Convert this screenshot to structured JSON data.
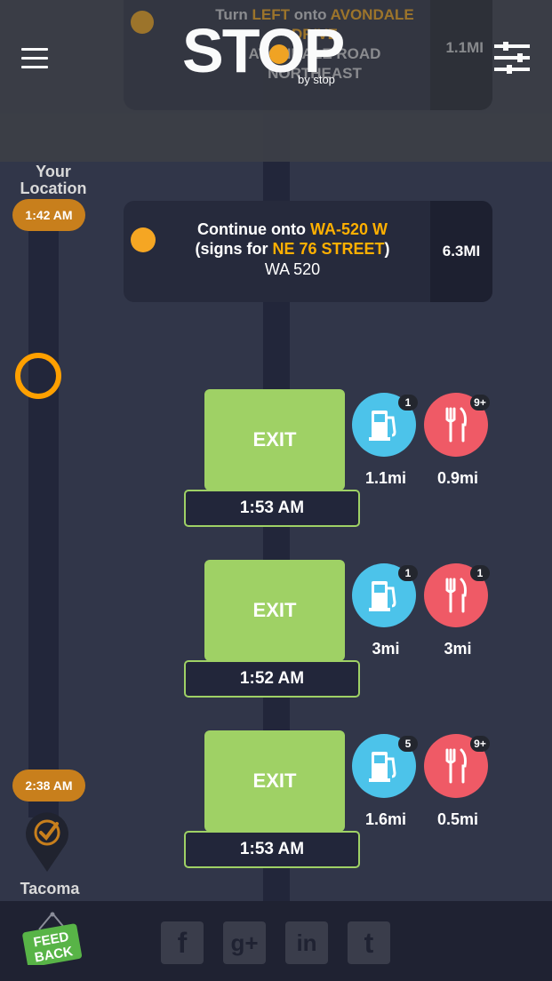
{
  "header": {
    "prev_step": {
      "text_parts": [
        "Turn ",
        "LEFT",
        " onto ",
        "AVONDALE"
      ],
      "line2": "DRIVE",
      "line3": "AVONDALE ROAD",
      "line4": "NORTHEAST",
      "distance": "1.1MI"
    },
    "logo_text": "STOP",
    "logo_sub": "by stop"
  },
  "route": {
    "origin_label": "Your Location",
    "origin_time": "1:42 AM",
    "destination_time": "2:38 AM",
    "destination_label": "Tacoma"
  },
  "direction": {
    "prefix": "Continue onto ",
    "road": "WA-520 W",
    "signs_prefix": "(signs for ",
    "signs_road": "NE 76 STREET",
    "signs_suffix": ")",
    "road_name": "WA 520",
    "distance": "6.3MI"
  },
  "exits": [
    {
      "label": "EXIT",
      "time": "1:53 AM",
      "gas_count": "1",
      "gas_dist": "1.1mi",
      "food_count": "9+",
      "food_dist": "0.9mi"
    },
    {
      "label": "EXIT",
      "time": "1:52 AM",
      "gas_count": "1",
      "gas_dist": "3mi",
      "food_count": "1",
      "food_dist": "3mi"
    },
    {
      "label": "EXIT",
      "time": "1:53 AM",
      "gas_count": "5",
      "gas_dist": "1.6mi",
      "food_count": "9+",
      "food_dist": "0.5mi"
    }
  ],
  "footer": {
    "feedback_line1": "FEED",
    "feedback_line2": "BACK",
    "social": [
      "facebook",
      "google-plus",
      "linkedin",
      "twitter"
    ],
    "social_glyphs": [
      "f",
      "g+",
      "in",
      "t"
    ]
  },
  "colors": {
    "accent": "#ffb000",
    "exit": "#9fd165",
    "gas": "#4cc3ea",
    "food": "#ef5a66",
    "feedback": "#58b447"
  }
}
